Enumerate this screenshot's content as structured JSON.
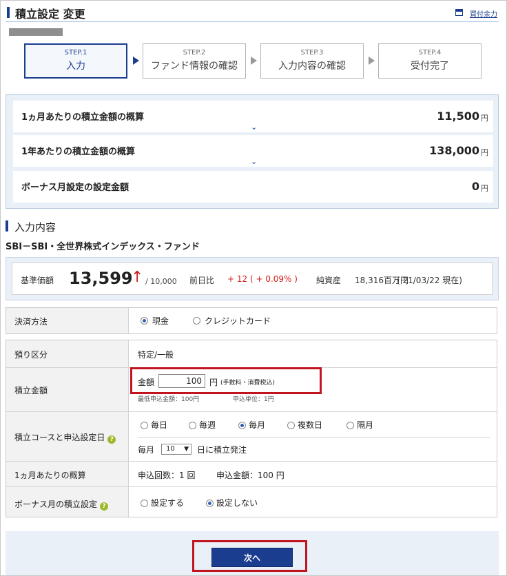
{
  "header": {
    "title": "積立設定 変更",
    "link": "買付余力"
  },
  "steps": [
    {
      "num": "STEP.1",
      "label": "入力"
    },
    {
      "num": "STEP.2",
      "label": "ファンド情報の確認"
    },
    {
      "num": "STEP.3",
      "label": "入力内容の確認"
    },
    {
      "num": "STEP.4",
      "label": "受付完了"
    }
  ],
  "summary": [
    {
      "label": "1ヵ月あたりの積立金額の概算",
      "value": "11,500",
      "unit": "円"
    },
    {
      "label": "1年あたりの積立金額の概算",
      "value": "138,000",
      "unit": "円"
    },
    {
      "label": "ボーナス月設定の設定金額",
      "value": "0",
      "unit": "円"
    }
  ],
  "section_title": "入力内容",
  "fund_name": "SBI－SBI・全世界株式インデックス・ファンド",
  "price": {
    "label": "基準価額",
    "value": "13,599",
    "arrow": "↑",
    "per": "/ 10,000",
    "change_label": "前日比",
    "change_value": "+ 12 ( + 0.09% )",
    "assets_label": "純資産",
    "assets_value": "18,316百万円",
    "date": "( 21/03/22 現在)"
  },
  "payment": {
    "label": "決済方法",
    "options": [
      "現金",
      "クレジットカード"
    ],
    "selected": "現金"
  },
  "deposit": {
    "label": "預り区分",
    "value": "特定/一般"
  },
  "amount": {
    "label": "積立金額",
    "field_label": "金額",
    "value": "100",
    "unit": "円",
    "note": "(手数料・消費税込)",
    "min_note": "最低申込金額：100円",
    "unit_note": "申込単位：1円"
  },
  "course": {
    "label": "積立コースと申込設定日",
    "options": [
      "毎日",
      "毎週",
      "毎月",
      "複数日",
      "隔月"
    ],
    "selected": "毎月",
    "day_prefix": "毎月",
    "day_value": "10",
    "day_suffix": "日に積立発注"
  },
  "monthly": {
    "label": "1ヵ月あたりの概算",
    "count": "申込回数：1 回",
    "amount": "申込金額：100 円"
  },
  "bonus": {
    "label": "ボーナス月の積立設定",
    "options": [
      "設定する",
      "設定しない"
    ],
    "selected": "設定しない"
  },
  "next_button": "次へ",
  "colors": {
    "accent": "#1b3d8f",
    "highlight": "#c2131e",
    "price_up": "#d21d1d"
  }
}
